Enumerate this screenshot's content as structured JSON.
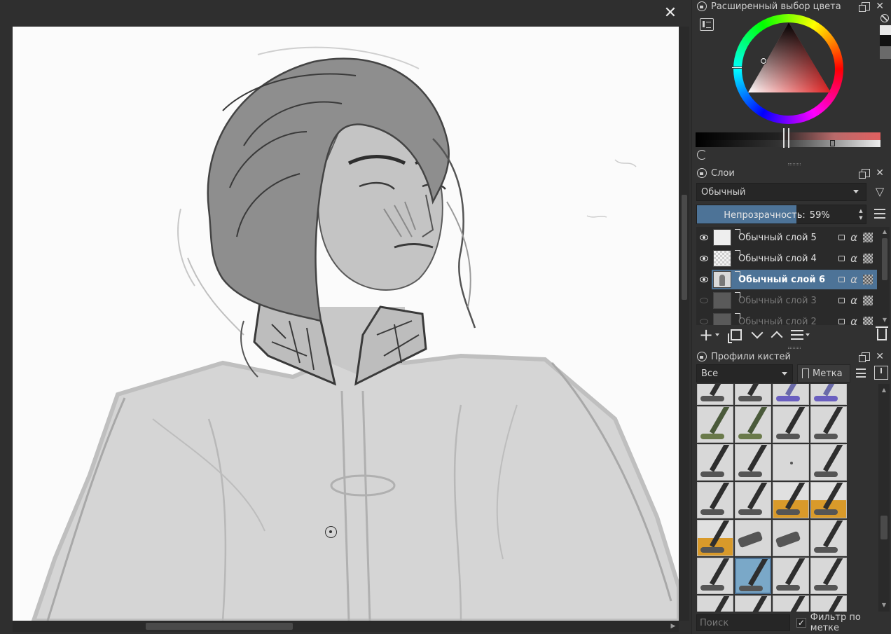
{
  "canvas": {
    "close_glyph": "✕"
  },
  "color_panel": {
    "title": "Расширенный выбор цвета",
    "accent": "#d94a4a"
  },
  "layers_panel": {
    "title": "Слои",
    "blend_mode": "Обычный",
    "opacity_label": "Непрозрачность:",
    "opacity_value": "59%",
    "opacity_fraction": 0.59,
    "layers": [
      {
        "name": "Обычный слой 5",
        "visible": true,
        "selected": false,
        "thumb": "white"
      },
      {
        "name": "Обычный слой 4",
        "visible": true,
        "selected": false,
        "thumb": "grid"
      },
      {
        "name": "Обычный слой 6",
        "visible": true,
        "selected": true,
        "thumb": "figure"
      },
      {
        "name": "Обычный слой 3",
        "visible": false,
        "selected": false,
        "thumb": "dark"
      },
      {
        "name": "Обычный слой 2",
        "visible": false,
        "selected": false,
        "thumb": "dark"
      }
    ],
    "alpha_glyph": "α"
  },
  "brush_panel": {
    "title": "Профили кистей",
    "tag_filter": "Все",
    "tag_button": "Метка",
    "search_placeholder": "Поиск",
    "filter_by_tag_label": "Фильтр по метке",
    "filter_by_tag_checked": true,
    "check_glyph": "✓"
  },
  "icons": {
    "filter": "▽",
    "up": "▲",
    "down": "▼",
    "right": "▶",
    "close": "✕"
  }
}
